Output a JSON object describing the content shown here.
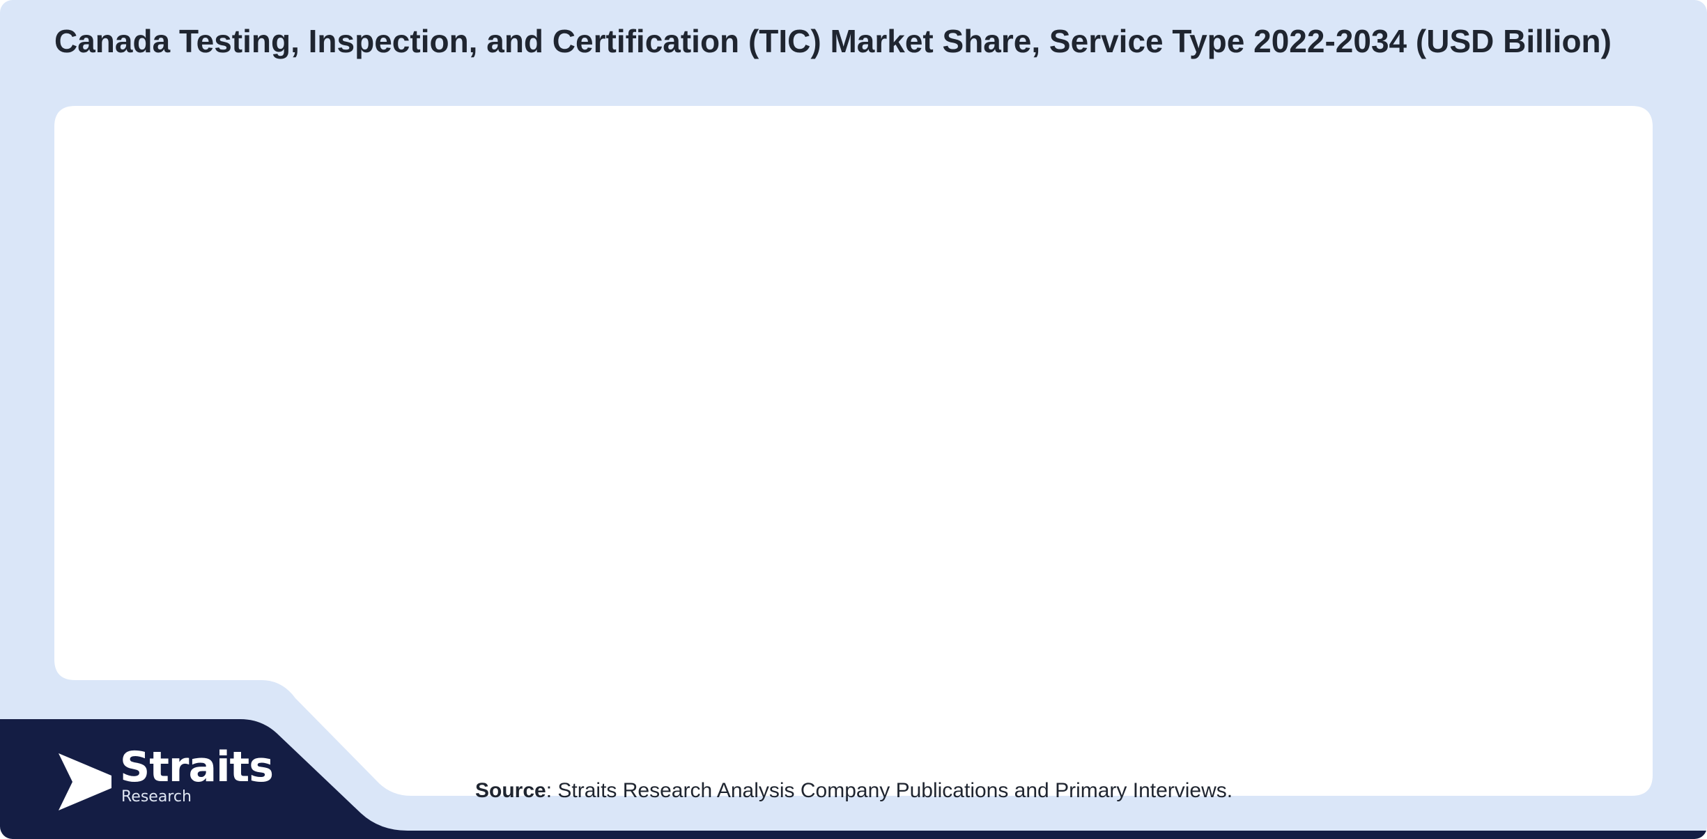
{
  "chart_data": {
    "type": "bar",
    "title": "Canada Testing, Inspection, and Certification (TIC) Market Share, Service Type 2022-2034 (USD Billion)",
    "categories": [],
    "series": []
  },
  "footer": {
    "source_label": "Source",
    "source_text": ": Straits Research Analysis Company Publications and Primary Interviews."
  },
  "logo": {
    "name": "Straits",
    "subtitle": "Research",
    "icon": "arrow-logo-icon"
  },
  "colors": {
    "background": "#dae6f8",
    "panel": "#ffffff",
    "footer_dark": "#141d44",
    "text": "#1f2530"
  }
}
